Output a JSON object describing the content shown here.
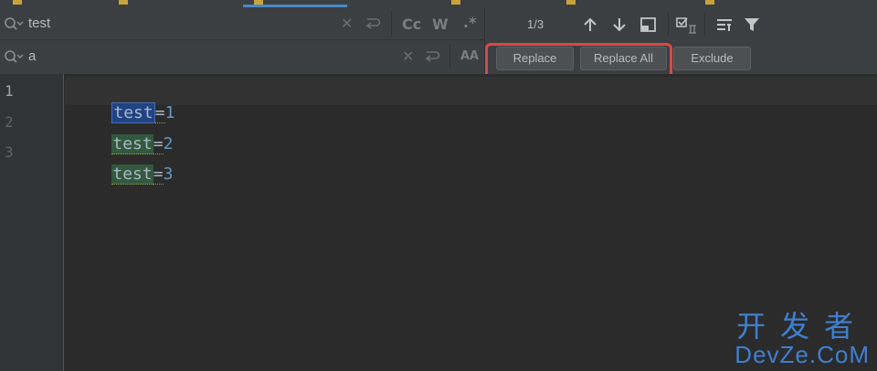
{
  "tabs": {
    "active_index": 2
  },
  "find": {
    "search_value": "test",
    "replace_value": "a",
    "icons": {
      "search": "search-history-icon",
      "clear": "clear-icon",
      "new_line": "new-line-icon",
      "match_case": "match-case-icon",
      "words": "whole-words-icon",
      "regex": "regex-icon",
      "preserve_case": "preserve-case-icon"
    },
    "opt_match_case": "Cc",
    "opt_words": "W",
    "opt_regex": ".*",
    "opt_preserve_case": "AA"
  },
  "toolbar": {
    "match_count": "1/3",
    "icons": [
      "previous-occurrence-icon",
      "next-occurrence-icon",
      "select-all-occurrences-icon",
      "in-selection-icon",
      "filter-search-results-icon",
      "filter-icon"
    ]
  },
  "actions": {
    "replace": "Replace",
    "replace_all": "Replace All",
    "exclude": "Exclude"
  },
  "editor": {
    "lines": [
      {
        "number": "1",
        "key": "test",
        "eq": "=",
        "value": "1"
      },
      {
        "number": "2",
        "key": "test",
        "eq": "=",
        "value": "2"
      },
      {
        "number": "3",
        "key": "test",
        "eq": "=",
        "value": "3"
      }
    ],
    "current_line": 1
  },
  "watermark": {
    "line1": "开发者",
    "line2": "DevZe.CoM"
  },
  "colors": {
    "background": "#2b2b2b",
    "panel": "#3c3f41",
    "match_highlight": "#32593d",
    "selection": "#214283",
    "number": "#6897bb",
    "annotation_red": "#e04545",
    "watermark": "#3f7fd1"
  }
}
